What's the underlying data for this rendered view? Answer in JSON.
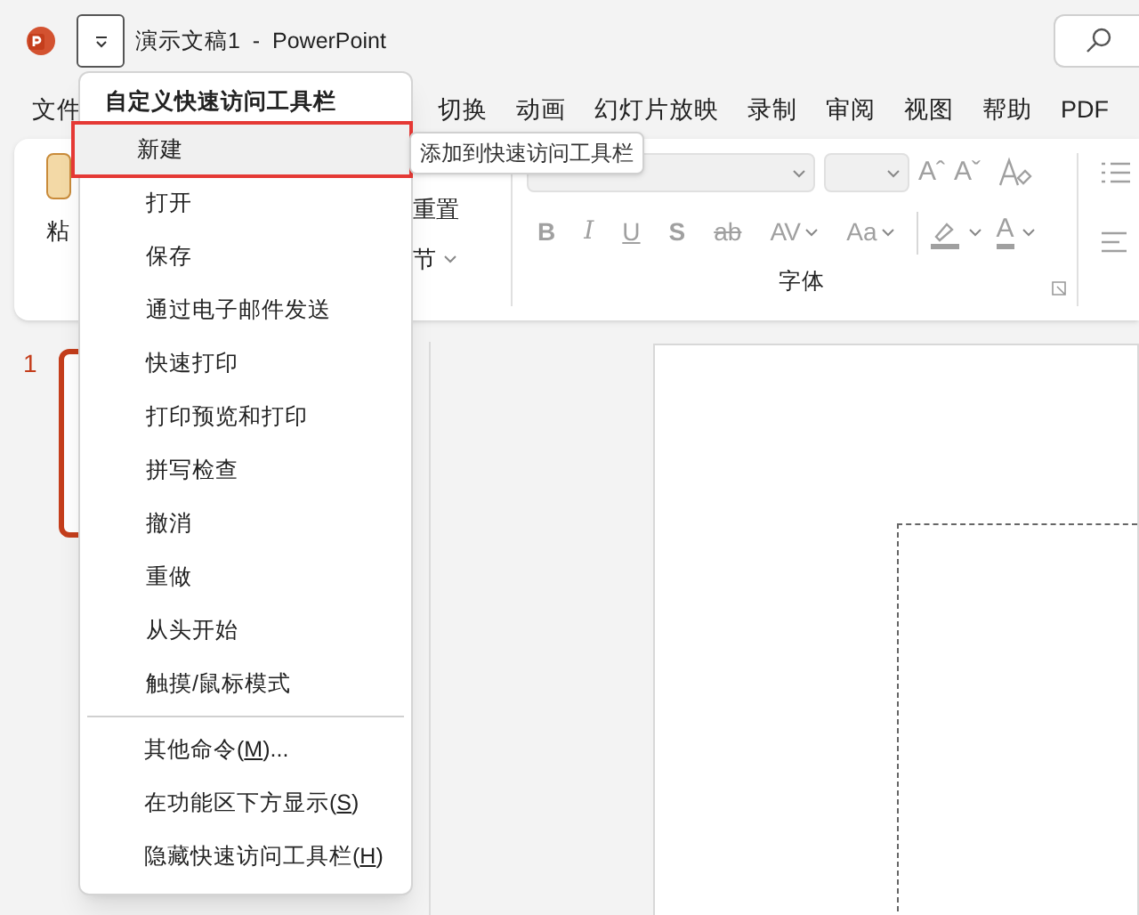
{
  "window": {
    "title": "演示文稿1  -  PowerPoint"
  },
  "ribbon_tabs": [
    {
      "label": "文件",
      "selected": false
    },
    {
      "label": "切换",
      "selected": false
    },
    {
      "label": "动画",
      "selected": false
    },
    {
      "label": "幻灯片放映",
      "selected": false
    },
    {
      "label": "录制",
      "selected": false
    },
    {
      "label": "审阅",
      "selected": false
    },
    {
      "label": "视图",
      "selected": false
    },
    {
      "label": "帮助",
      "selected": false
    },
    {
      "label": "PDF",
      "selected": false
    }
  ],
  "ribbon": {
    "paste_label": "粘",
    "slides_group": [
      {
        "label": "重置",
        "dropdown": false
      },
      {
        "label": "节",
        "dropdown": true
      }
    ],
    "font_group": {
      "label": "字体",
      "size_buttons": [
        "Aˆ",
        "Aˇ"
      ],
      "format_buttons": [
        {
          "label": "B",
          "kind": "bold",
          "dropdown": false
        },
        {
          "label": "I",
          "kind": "italic",
          "dropdown": false
        },
        {
          "label": "U",
          "kind": "underline",
          "dropdown": false
        },
        {
          "label": "S",
          "kind": "shadow",
          "dropdown": false
        },
        {
          "label": "ab",
          "kind": "strike",
          "dropdown": false
        },
        {
          "label": "AV",
          "kind": "spacing",
          "dropdown": true
        },
        {
          "label": "Aa",
          "kind": "case",
          "dropdown": true
        }
      ],
      "color_buttons": [
        {
          "kind": "highlight"
        },
        {
          "kind": "fontcolor",
          "label": "A"
        }
      ],
      "disabled": true
    }
  },
  "slide_panel": {
    "slides": [
      {
        "number": "1",
        "selected": true
      }
    ]
  },
  "qat_menu": {
    "title": "自定义快速访问工具栏",
    "items": [
      {
        "label": "新建",
        "highlighted": true
      },
      {
        "label": "打开",
        "highlighted": false
      },
      {
        "label": "保存",
        "highlighted": false
      },
      {
        "label": "通过电子邮件发送",
        "highlighted": false
      },
      {
        "label": "快速打印",
        "highlighted": false
      },
      {
        "label": "打印预览和打印",
        "highlighted": false
      },
      {
        "label": "拼写检查",
        "highlighted": false
      },
      {
        "label": "撤消",
        "highlighted": false
      },
      {
        "label": "重做",
        "highlighted": false
      },
      {
        "label": "从头开始",
        "highlighted": false
      },
      {
        "label": "触摸/鼠标模式",
        "highlighted": false
      }
    ],
    "commands": [
      {
        "label": "其他命令(",
        "access_key": "M",
        "suffix": ")..."
      },
      {
        "label": "在功能区下方显示(",
        "access_key": "S",
        "suffix": ")"
      },
      {
        "label": "隐藏快速访问工具栏(",
        "access_key": "H",
        "suffix": ")"
      }
    ]
  },
  "tooltip": "添加到快速访问工具栏"
}
